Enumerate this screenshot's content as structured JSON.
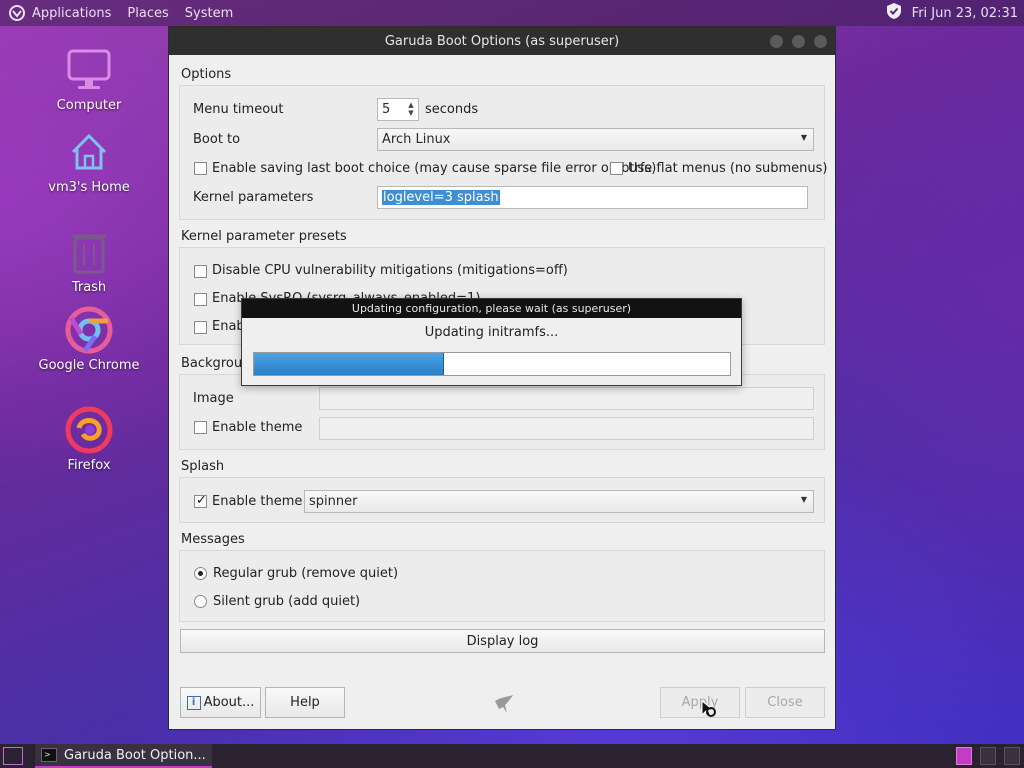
{
  "top_panel": {
    "menus": [
      "Applications",
      "Places",
      "System"
    ],
    "clock": "Fri Jun 23, 02:31"
  },
  "desktop_icons": [
    {
      "label": "Computer",
      "icon": "computer-icon"
    },
    {
      "label": "vm3's Home",
      "icon": "home-folder-icon"
    },
    {
      "label": "Trash",
      "icon": "trash-icon"
    },
    {
      "label": "Google Chrome",
      "icon": "chrome-icon"
    },
    {
      "label": "Firefox",
      "icon": "firefox-icon"
    }
  ],
  "window": {
    "title": "Garuda Boot Options (as superuser)",
    "options": {
      "section": "Options",
      "menu_timeout_label": "Menu timeout",
      "menu_timeout_value": "5",
      "menu_timeout_unit": "seconds",
      "boot_to_label": "Boot to",
      "boot_to_value": "Arch Linux",
      "save_last_label": "Enable saving last boot choice (may cause sparse file error on btrfs)",
      "save_last_checked": false,
      "flat_menus_label": "Use flat menus (no submenus)",
      "flat_menus_checked": false,
      "kernel_params_label": "Kernel parameters",
      "kernel_params_value": "loglevel=3 splash"
    },
    "presets": {
      "section": "Kernel parameter presets",
      "items": [
        "Disable CPU vulnerability mitigations (mitigations=off)",
        "Enable SysRQ (sysrq_always_enabled=1)",
        "Enabl"
      ]
    },
    "background": {
      "section": "Backgroun",
      "image_label": "Image",
      "image_value": "",
      "theme_label": "Enable theme",
      "theme_value": ""
    },
    "splash": {
      "section": "Splash",
      "theme_label": "Enable theme",
      "theme_checked": true,
      "theme_value": "spinner"
    },
    "messages": {
      "section": "Messages",
      "regular_label": "Regular grub (remove quiet)",
      "silent_label": "Silent grub (add quiet)",
      "selected": "regular"
    },
    "display_log_label": "Display log",
    "buttons": {
      "about": "About...",
      "help": "Help",
      "apply": "Apply",
      "close": "Close"
    }
  },
  "progress_dialog": {
    "title": "Updating configuration, please wait (as superuser)",
    "message": "Updating initramfs...",
    "progress_fraction": 0.4
  },
  "taskbar": {
    "task_label": "Garuda Boot Option..."
  }
}
